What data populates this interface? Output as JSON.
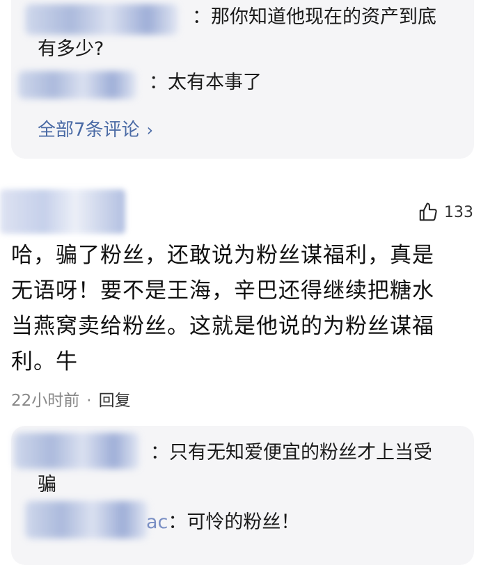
{
  "thread1": {
    "replies": [
      {
        "text": "：那你知道他现在的资产到底",
        "text2": "有多少?"
      },
      {
        "text": "：太有本事了"
      }
    ],
    "see_all": "全部7条评论"
  },
  "comment": {
    "likes": "133",
    "body_line1": "哈，骗了粉丝，还敢说为粉丝谋福利，真是",
    "body_line2": "无语呀！要不是王海，辛巴还得继续把糖水",
    "body_line3": "当燕窝卖给粉丝。这就是他说的为粉丝谋福",
    "body_line4": "利。牛",
    "time": "22小时前",
    "separator": "·",
    "reply_label": "回复"
  },
  "thread2": {
    "replies": [
      {
        "text": "：只有无知爱便宜的粉丝才上当受",
        "text2": "骗"
      },
      {
        "name_tail": "ac",
        "text": "：可怜的粉丝！"
      }
    ]
  }
}
